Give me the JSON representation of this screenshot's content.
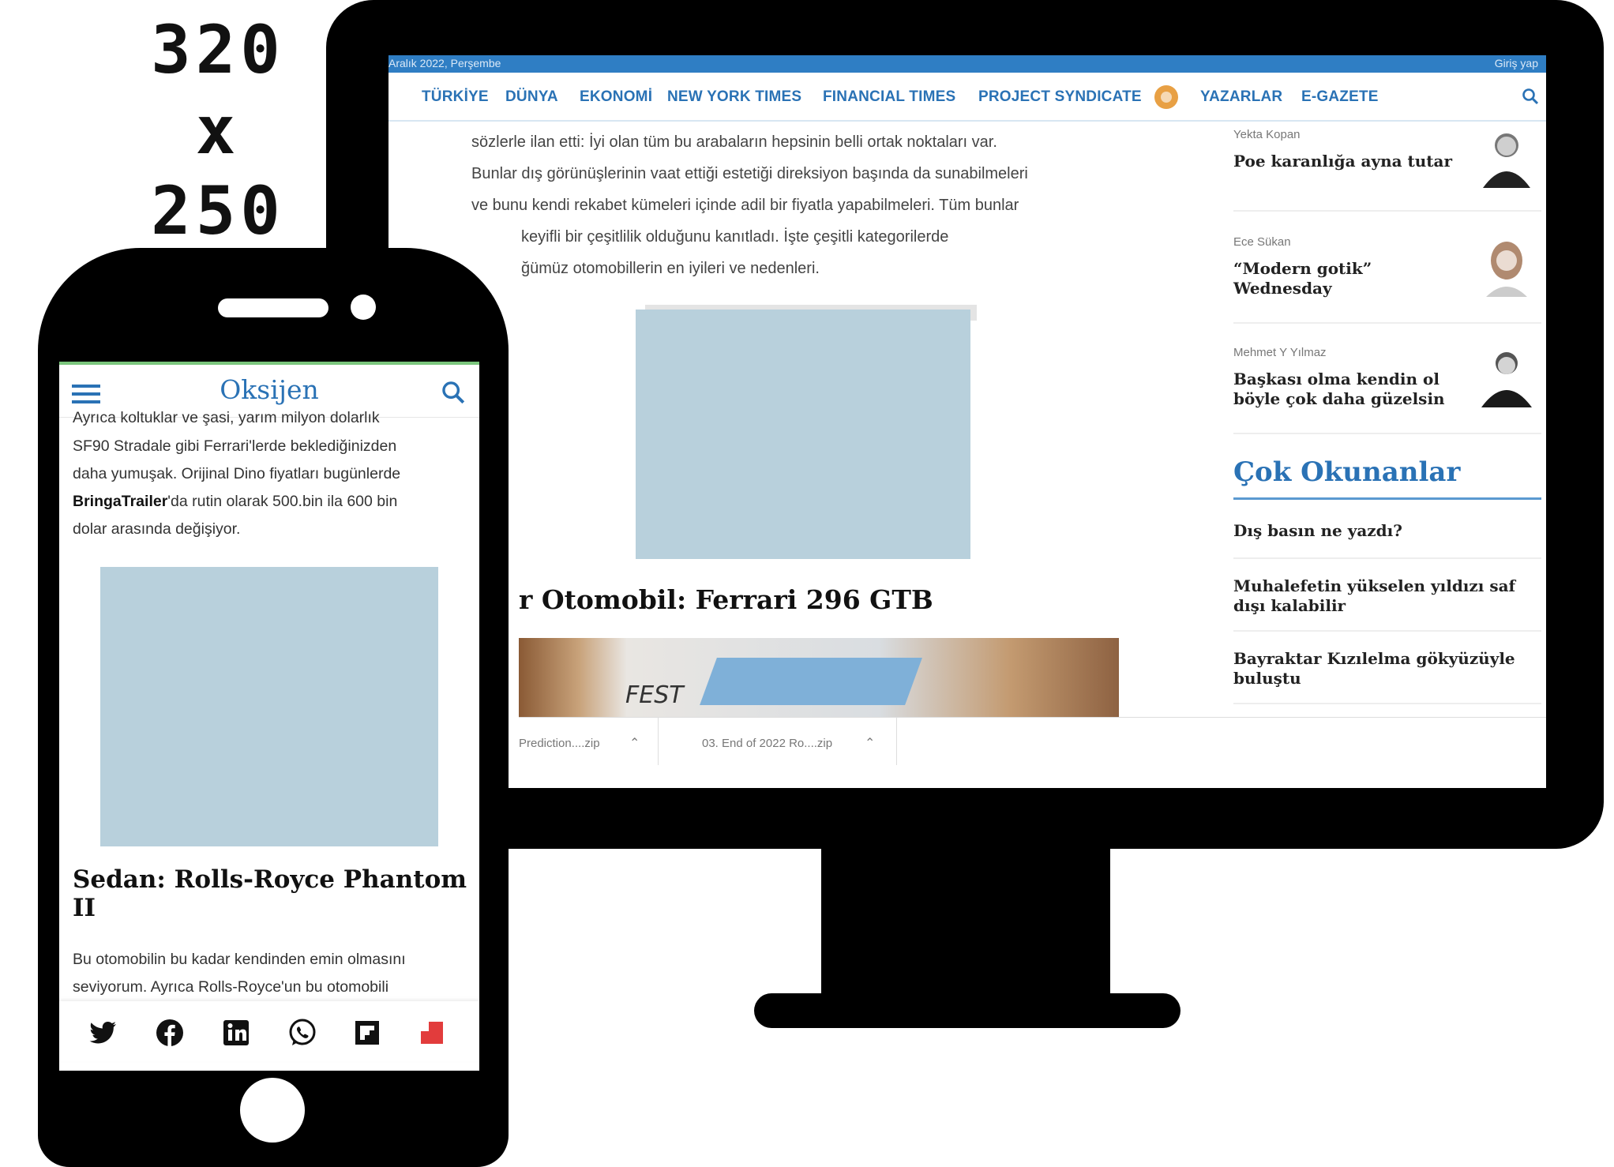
{
  "size_label": {
    "width": "320",
    "x": "x",
    "height": "250"
  },
  "desktop": {
    "topbar": {
      "date": "Aralık 2022, Perşembe",
      "login": "Giriş yap"
    },
    "nav": [
      "TÜRKİYE",
      "DÜNYA",
      "EKONOMİ",
      "NEW YORK TIMES",
      "FINANCIAL TIMES",
      "PROJECT SYNDICATE",
      "YAZARLAR",
      "E-GAZETE"
    ],
    "article_lines": [
      "sözlerle ilan etti: İyi olan tüm bu arabaların hepsinin belli ortak noktaları var.",
      "Bunlar dış görünüşlerinin vaat ettiği estetiği direksiyon başında da sunabilmeleri",
      "ve bunu kendi rekabet kümeleri içinde adil bir fiyatla yapabilmeleri. Tüm bunlar",
      "keyifli bir çeşitlilik olduğunu kanıtladı. İşte çeşitli kategorilerde",
      "ğümüz otomobillerin en iyileri ve nedenleri."
    ],
    "section_heading": "r Otomobil: Ferrari 296 GTB",
    "banner_text": "FEST",
    "downloads": [
      "Prediction....zip",
      "03. End of 2022 Ro....zip"
    ],
    "authors": [
      {
        "name": "Yekta Kopan",
        "title": "Poe karanlığa ayna tutar"
      },
      {
        "name": "Ece Sükan",
        "title": "“Modern gotik” Wednesday"
      },
      {
        "name": "Mehmet Y Yılmaz",
        "title": "Başkası olma kendin ol böyle çok daha güzelsin"
      }
    ],
    "most_read_title": "Çok Okunanlar",
    "most_read": [
      "Dış basın ne yazdı?",
      "Muhalefetin yükselen yıldızı saf dışı kalabilir",
      "Bayraktar Kızılelma gökyüzüyle buluştu"
    ]
  },
  "mobile": {
    "logo": "Oksijen",
    "intro_lines": [
      "Ayrıca koltuklar ve şasi, yarım milyon dolarlık",
      "SF90 Stradale gibi Ferrari'lerde beklediğinizden",
      "daha yumuşak. Orijinal Dino fiyatları bugünlerde"
    ],
    "intro_bold": "BringaTrailer",
    "intro_rest": "'da rutin olarak 500.bin ila 600 bin",
    "intro_last": "dolar arasında değişiyor.",
    "heading": "Sedan: Rolls-Royce Phantom II",
    "body_lines": [
      "Bu otomobilin bu kadar kendinden emin olmasını",
      "seviyorum. Ayrıca Rolls-Royce'un bu otomobili"
    ],
    "share_icons": [
      "twitter-icon",
      "facebook-icon",
      "linkedin-icon",
      "whatsapp-icon",
      "flipboard-icon",
      "bookmark-icon"
    ]
  },
  "colors": {
    "brand_blue": "#2a72b5",
    "placeholder": "#b8d0dc"
  }
}
